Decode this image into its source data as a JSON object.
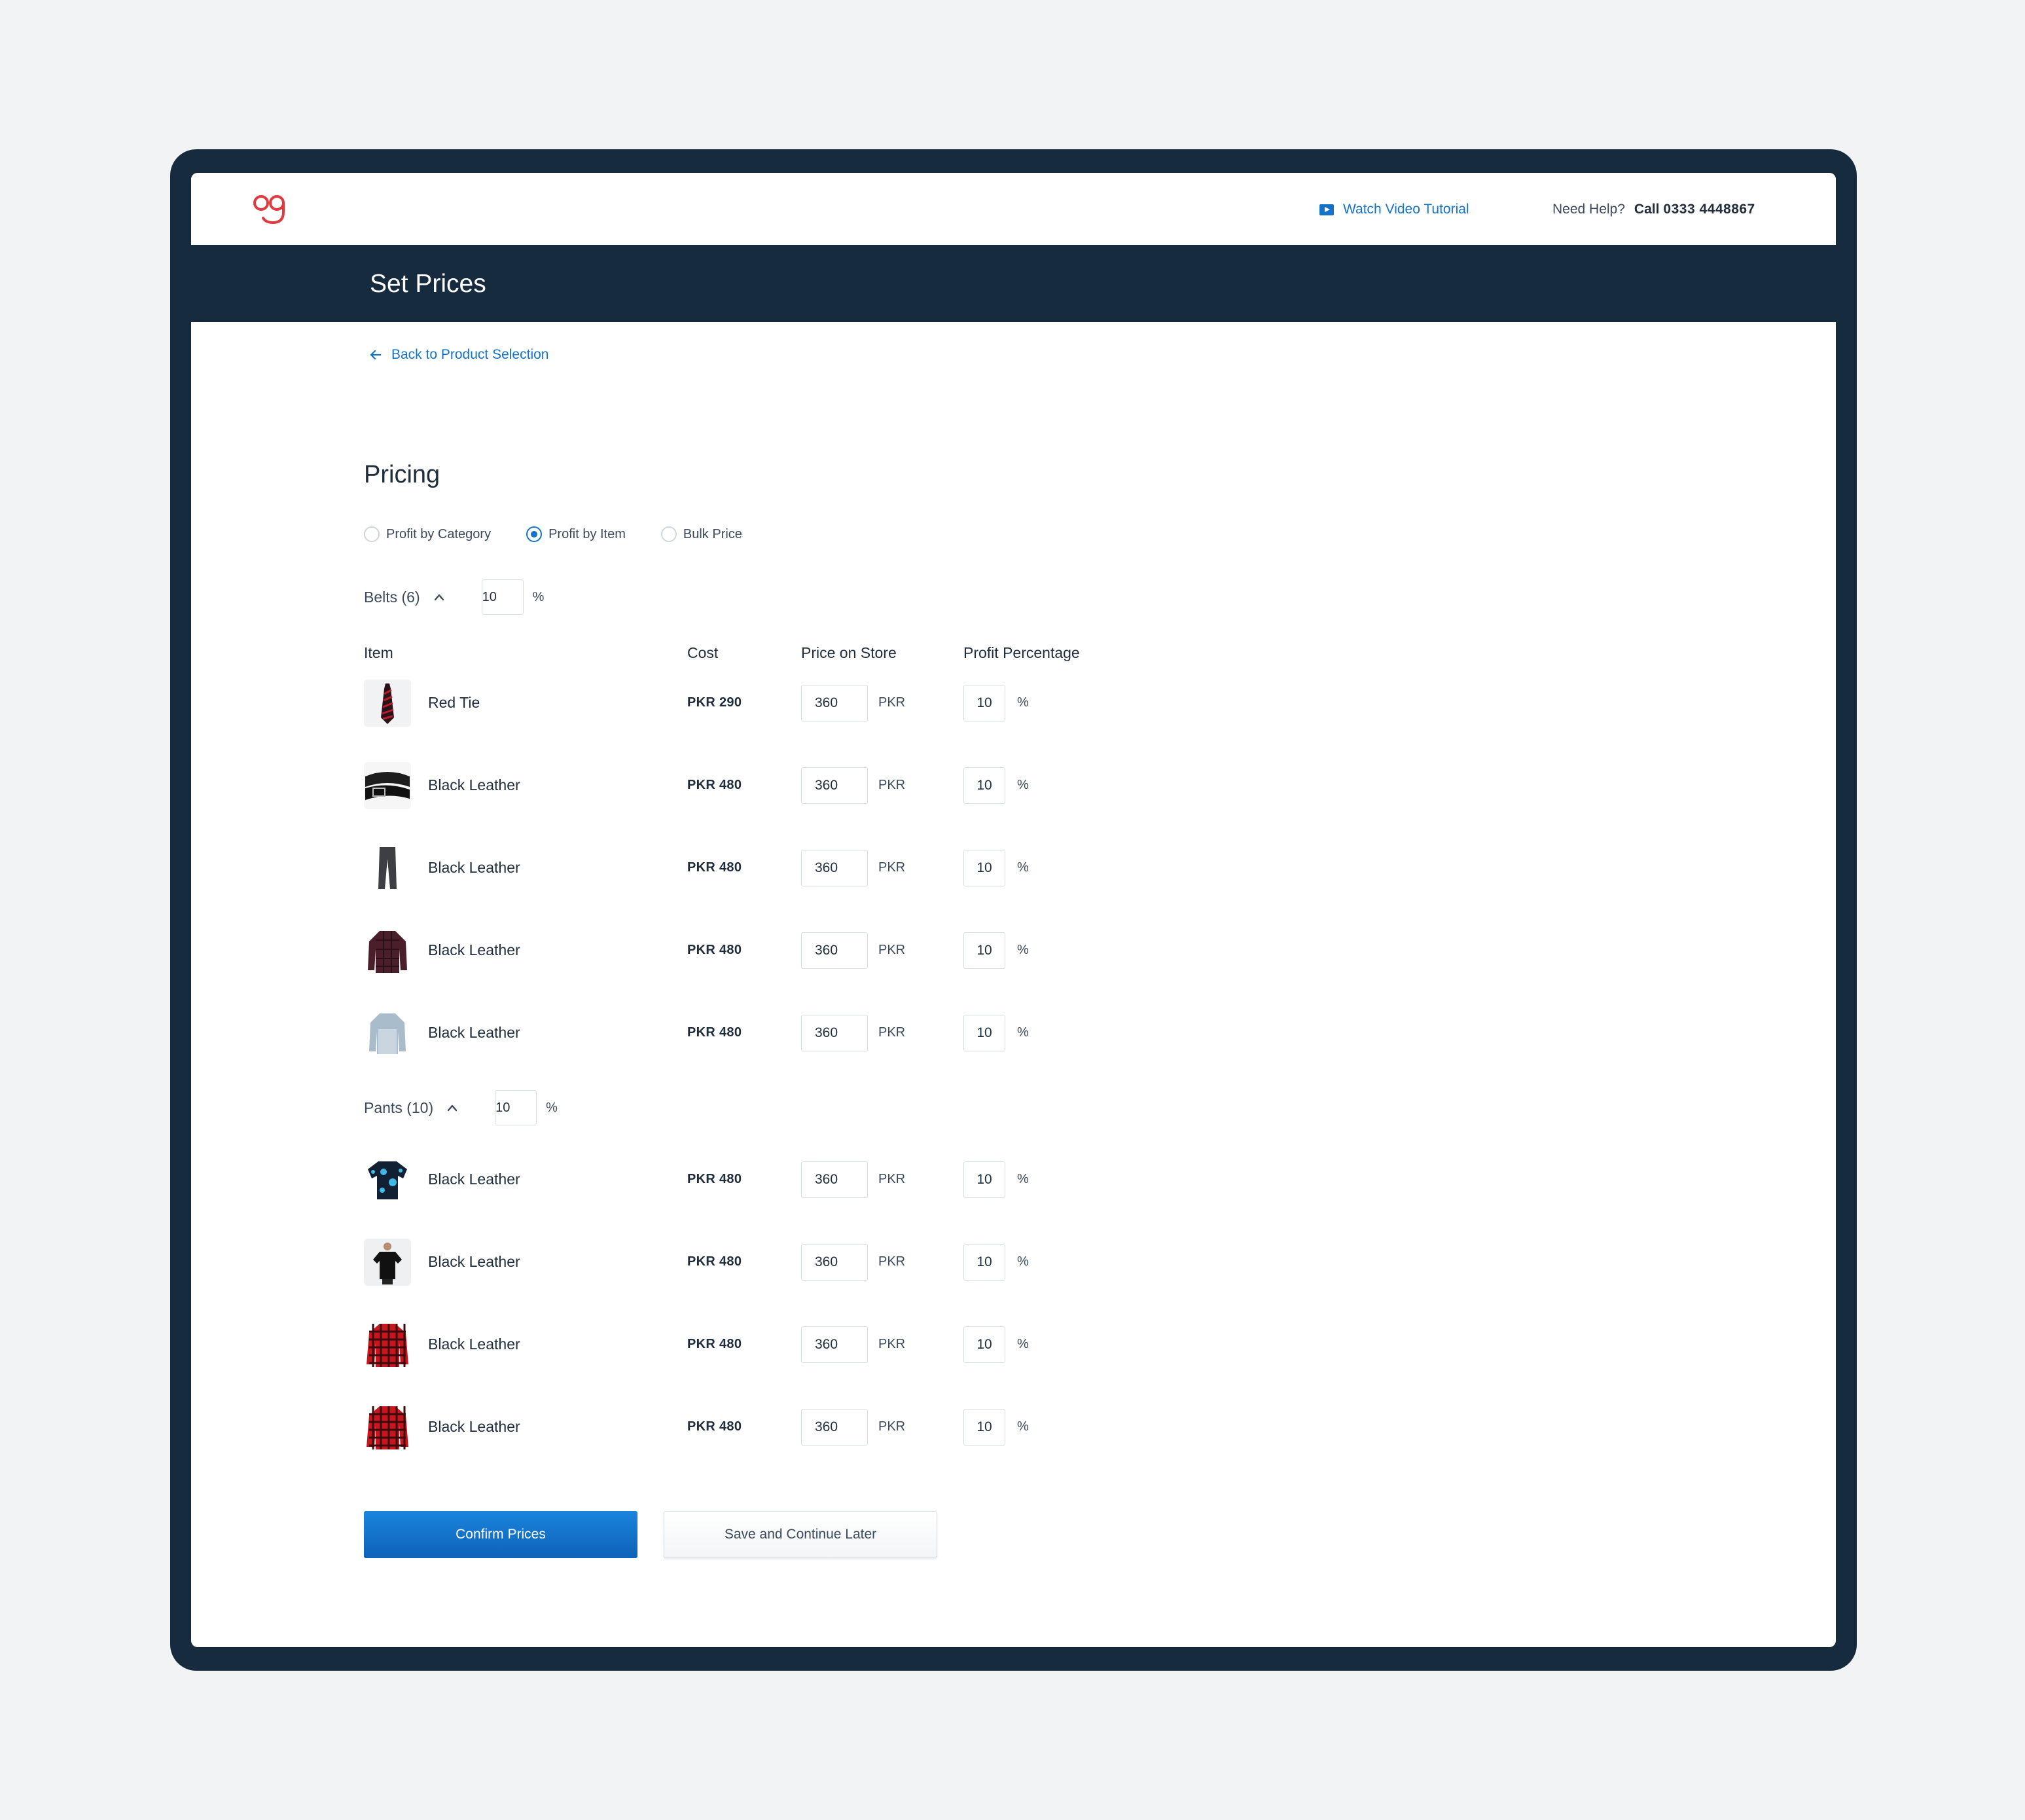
{
  "header": {
    "logo_text": "og",
    "tutorial_label": "Watch Video Tutorial",
    "help_question": "Need Help?",
    "help_call": "Call",
    "help_phone": "0333 4448867"
  },
  "page_title": "Set Prices",
  "back_link": "Back to Product Selection",
  "pricing": {
    "title": "Pricing",
    "options": [
      {
        "label": "Profit by Category",
        "selected": false
      },
      {
        "label": "Profit by Item",
        "selected": true
      },
      {
        "label": "Bulk Price",
        "selected": false
      }
    ]
  },
  "columns": {
    "item": "Item",
    "cost": "Cost",
    "price": "Price on Store",
    "profit": "Profit Percentage"
  },
  "categories": [
    {
      "name": "Belts (6)",
      "profit": "10",
      "pct": "%",
      "items": [
        {
          "name": "Red Tie",
          "cost": "PKR 290",
          "price": "360",
          "unit": "PKR",
          "profit": "10",
          "pct": "%",
          "thumb": "tie-image"
        },
        {
          "name": "Black Leather",
          "cost": "PKR 480",
          "price": "360",
          "unit": "PKR",
          "profit": "10",
          "pct": "%",
          "thumb": "belt-image"
        },
        {
          "name": "Black Leather",
          "cost": "PKR 480",
          "price": "360",
          "unit": "PKR",
          "profit": "10",
          "pct": "%",
          "thumb": "pants-image"
        },
        {
          "name": "Black Leather",
          "cost": "PKR 480",
          "price": "360",
          "unit": "PKR",
          "profit": "10",
          "pct": "%",
          "thumb": "plaid-jacket-image"
        },
        {
          "name": "Black Leather",
          "cost": "PKR 480",
          "price": "360",
          "unit": "PKR",
          "profit": "10",
          "pct": "%",
          "thumb": "denim-shirt-image"
        }
      ]
    },
    {
      "name": "Pants (10)",
      "profit": "10",
      "pct": "%",
      "items": [
        {
          "name": "Black Leather",
          "cost": "PKR 480",
          "price": "360",
          "unit": "PKR",
          "profit": "10",
          "pct": "%",
          "thumb": "printed-shirt-image"
        },
        {
          "name": "Black Leather",
          "cost": "PKR 480",
          "price": "360",
          "unit": "PKR",
          "profit": "10",
          "pct": "%",
          "thumb": "black-tshirt-image"
        },
        {
          "name": "Black Leather",
          "cost": "PKR 480",
          "price": "360",
          "unit": "PKR",
          "profit": "10",
          "pct": "%",
          "thumb": "red-check-shirt-image"
        },
        {
          "name": "Black Leather",
          "cost": "PKR 480",
          "price": "360",
          "unit": "PKR",
          "profit": "10",
          "pct": "%",
          "thumb": "red-check-shirt-image"
        }
      ]
    }
  ],
  "buttons": {
    "confirm": "Confirm Prices",
    "save": "Save and Continue Later"
  },
  "colors": {
    "navy": "#172b3f",
    "accent": "#1473c9",
    "logo": "#e0393e",
    "background": "#f2f3f5"
  }
}
